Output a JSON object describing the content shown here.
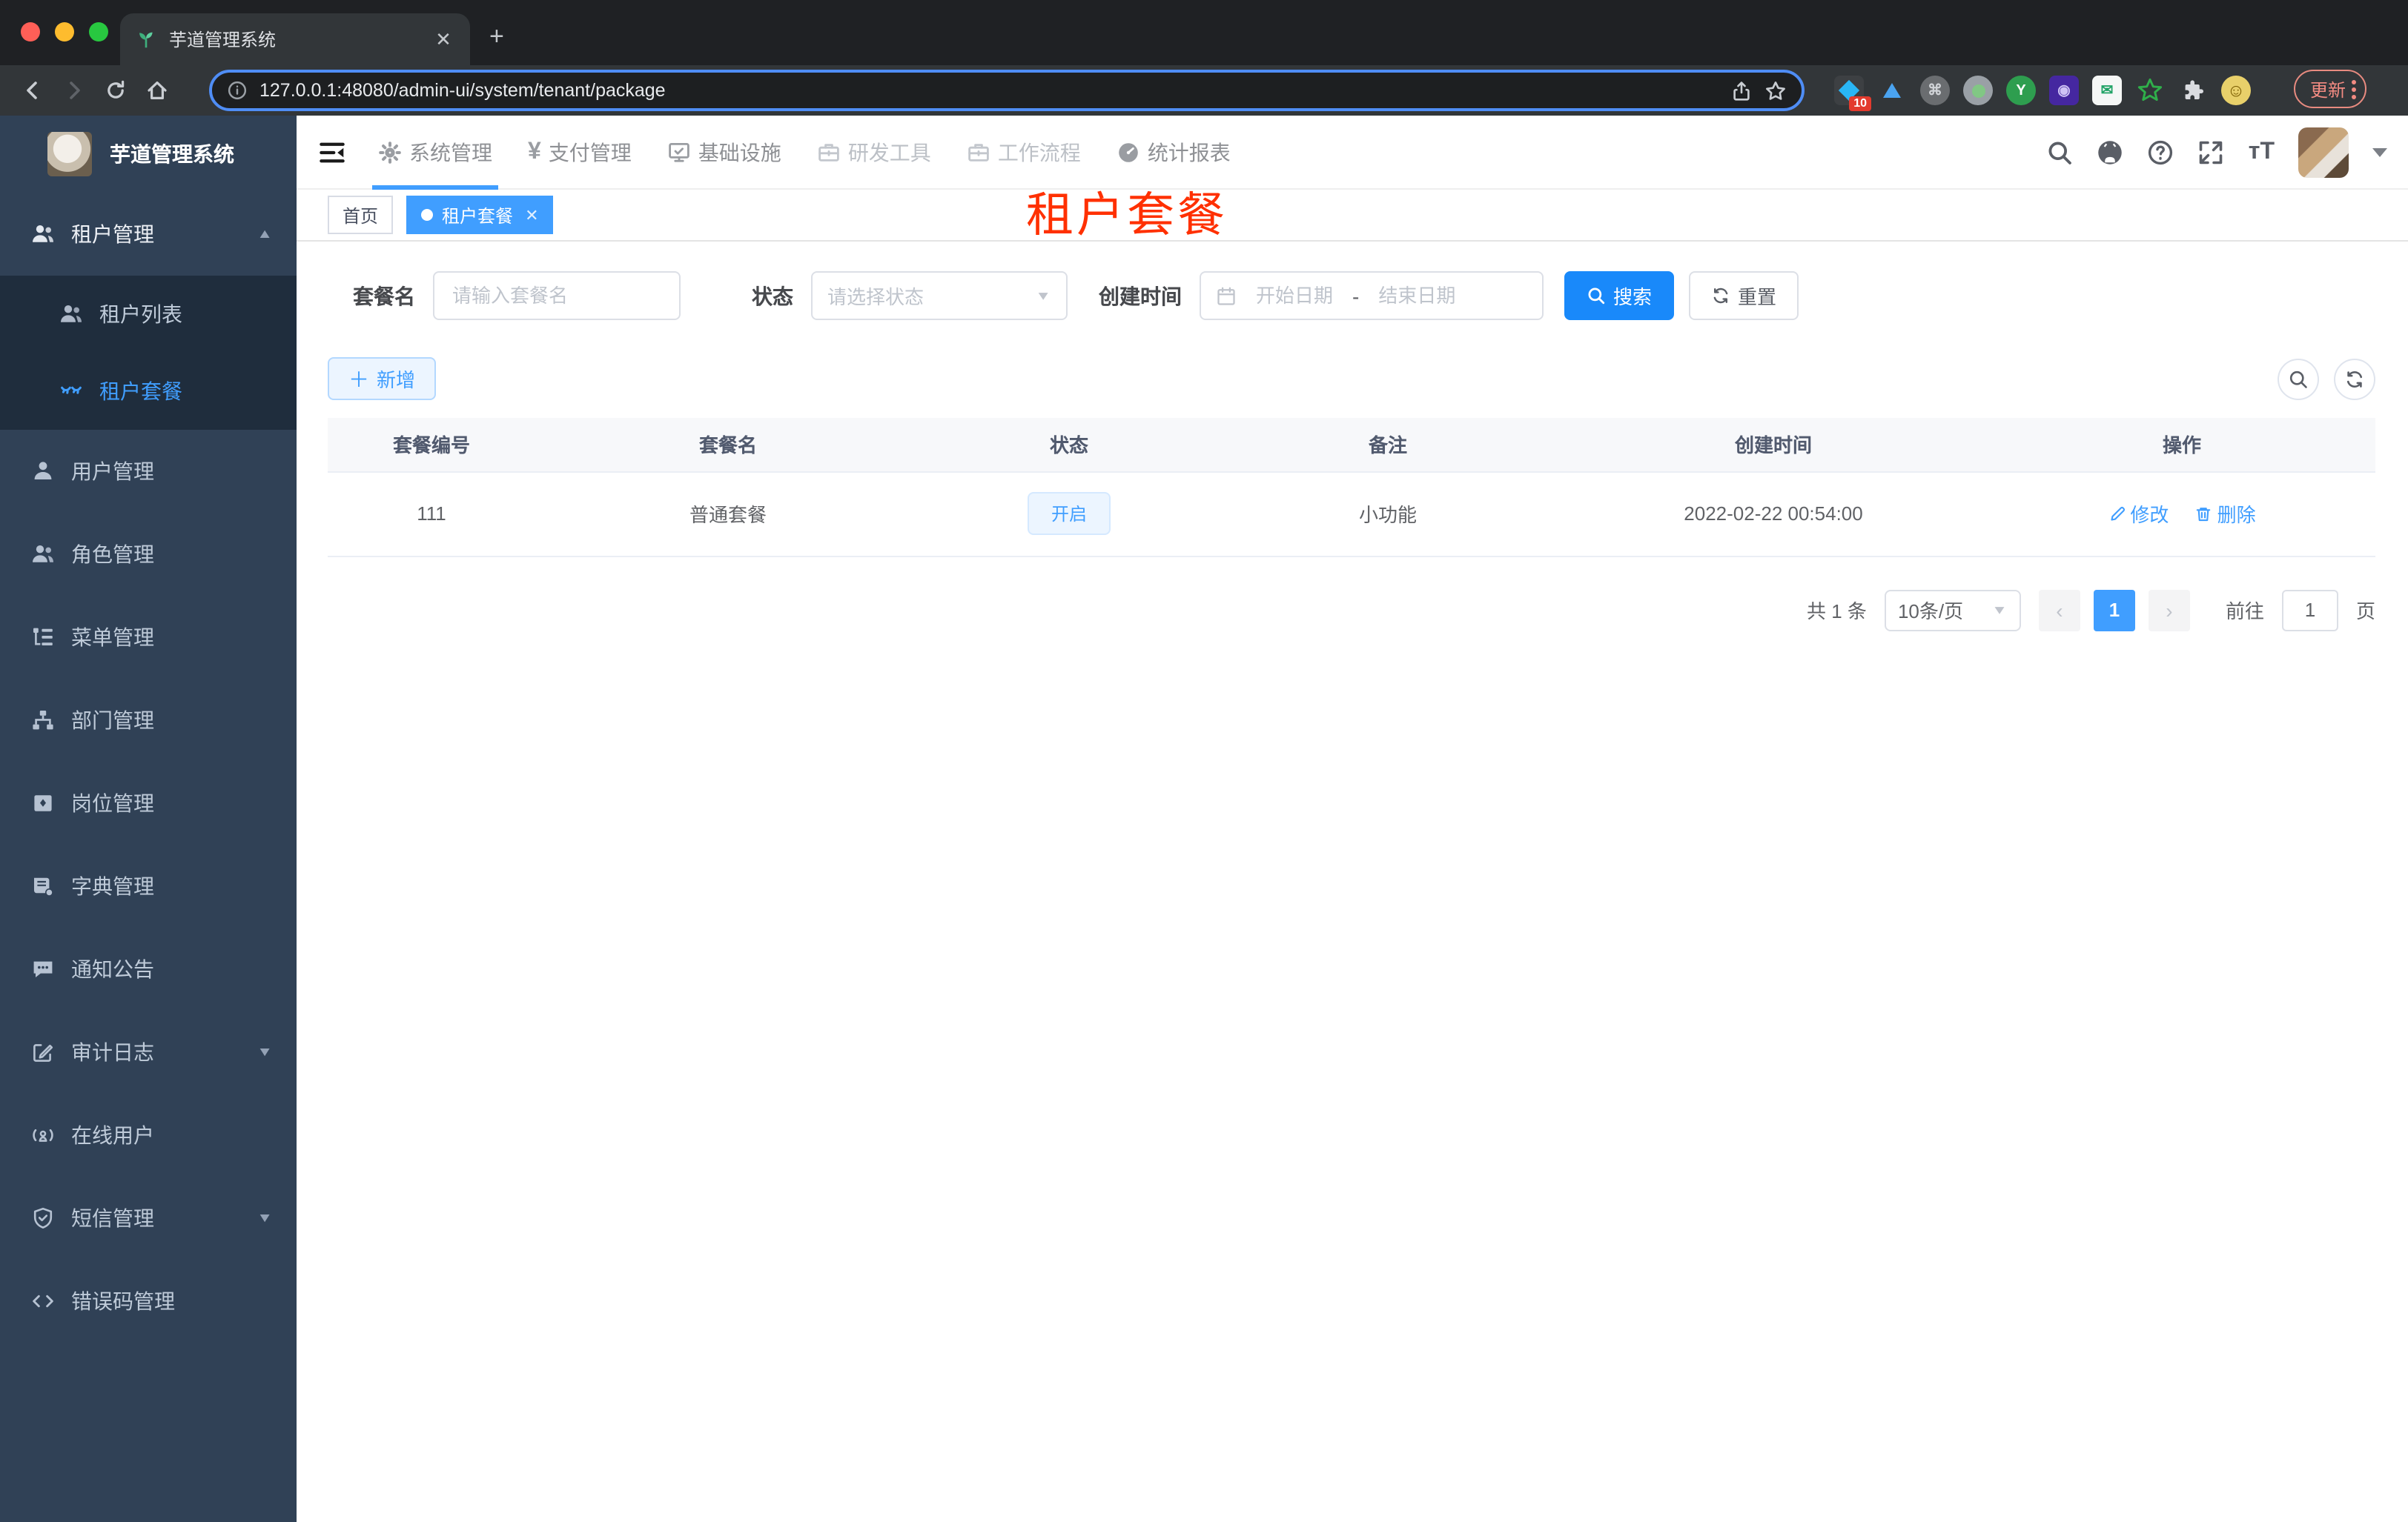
{
  "browser": {
    "tab_title": "芋道管理系统",
    "url": "127.0.0.1:48080/admin-ui/system/tenant/package",
    "update_button": "更新",
    "extension_badge": "10",
    "extension_letter": "Y"
  },
  "colors": {
    "accent": "#409eff",
    "primary_button": "#1989fa",
    "sidebar_bg": "#304156",
    "submenu_bg": "#1f2d3d",
    "annotation_red": "#ff3000",
    "status_tag_bg": "#ecf5ff"
  },
  "sidebar": {
    "app_title": "芋道管理系统",
    "items": [
      {
        "label": "租户管理"
      },
      {
        "label": "租户列表"
      },
      {
        "label": "租户套餐"
      },
      {
        "label": "用户管理"
      },
      {
        "label": "角色管理"
      },
      {
        "label": "菜单管理"
      },
      {
        "label": "部门管理"
      },
      {
        "label": "岗位管理"
      },
      {
        "label": "字典管理"
      },
      {
        "label": "通知公告"
      },
      {
        "label": "审计日志"
      },
      {
        "label": "在线用户"
      },
      {
        "label": "短信管理"
      },
      {
        "label": "错误码管理"
      }
    ]
  },
  "topnav": {
    "items": [
      {
        "label": "系统管理"
      },
      {
        "label": "支付管理"
      },
      {
        "label": "基础设施"
      },
      {
        "label": "研发工具"
      },
      {
        "label": "工作流程"
      },
      {
        "label": "统计报表"
      }
    ]
  },
  "tags": {
    "items": [
      {
        "label": "首页"
      },
      {
        "label": "租户套餐"
      }
    ]
  },
  "annotation": {
    "text": "租户套餐"
  },
  "filters": {
    "name_label": "套餐名",
    "name_placeholder": "请输入套餐名",
    "status_label": "状态",
    "status_placeholder": "请选择状态",
    "date_label": "创建时间",
    "date_start_placeholder": "开始日期",
    "date_separator": "-",
    "date_end_placeholder": "结束日期",
    "search_label": "搜索",
    "reset_label": "重置"
  },
  "toolbar": {
    "add_label": "新增"
  },
  "table": {
    "headers": [
      "套餐编号",
      "套餐名",
      "状态",
      "备注",
      "创建时间",
      "操作"
    ],
    "row": {
      "id": "111",
      "name": "普通套餐",
      "status": "开启",
      "remark": "小功能",
      "created_at": "2022-02-22 00:54:00",
      "edit_label": "修改",
      "delete_label": "删除"
    }
  },
  "pagination": {
    "total": "共 1 条",
    "page_size": "10条/页",
    "current_page": "1",
    "goto_label": "前往",
    "goto_value": "1",
    "unit_label": "页"
  }
}
